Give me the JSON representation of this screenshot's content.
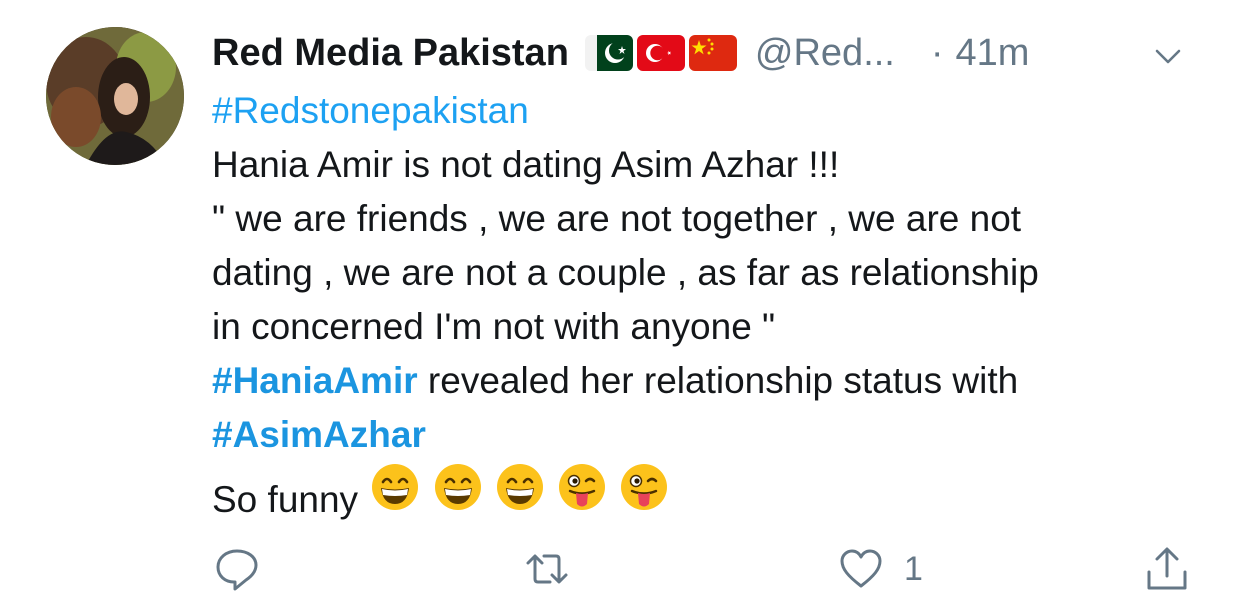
{
  "tweet": {
    "display_name": "Red Media Pakistan",
    "handle": "@Red...",
    "separator": "·",
    "time": "41m",
    "lines": {
      "l1": "#Redstonepakistan",
      "l2": "Hania Amir is not dating Asim Azhar !!!",
      "l3": "\" we are friends , we are not together , we are not",
      "l4": "dating , we are not a couple , as far as relationship",
      "l5": "in concerned I'm not with anyone \"",
      "l6_tag": "#HaniaAmir",
      "l6_rest": " revealed her relationship status with",
      "l7": "#AsimAzhar",
      "l8": "So funny"
    },
    "emojis": [
      "grinning-face-with-smiling-eyes",
      "grinning-face-with-smiling-eyes",
      "grinning-face-with-smiling-eyes",
      "winking-face-with-tongue",
      "winking-face-with-tongue"
    ],
    "flags": [
      "pakistan-flag",
      "turkey-flag",
      "china-flag"
    ],
    "actions": {
      "like_count": "1"
    }
  },
  "colors": {
    "link": "#1da1f2",
    "muted": "#657786",
    "text": "#14171a"
  }
}
